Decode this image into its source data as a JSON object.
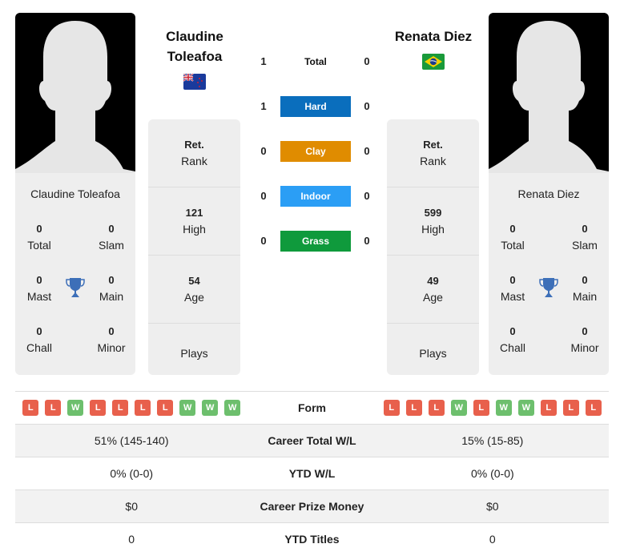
{
  "colors": {
    "hard": "#0a6ebd",
    "clay": "#e08c00",
    "indoor": "#2b9ef5",
    "grass": "#0f9a3c",
    "loss": "#e8604c",
    "win": "#6dbf6d",
    "trophy": "#3d6fb8"
  },
  "player1": {
    "name": "Claudine Toleafoa",
    "name_line1": "Claudine",
    "name_line2": "Toleafoa",
    "flag": "new-zealand",
    "rank_value": "Ret.",
    "rank_label": "Rank",
    "high_value": "121",
    "high_label": "High",
    "age_value": "54",
    "age_label": "Age",
    "plays_label": "Plays",
    "titles": {
      "total": "0",
      "total_label": "Total",
      "slam": "0",
      "slam_label": "Slam",
      "mast": "0",
      "mast_label": "Mast",
      "main": "0",
      "main_label": "Main",
      "chall": "0",
      "chall_label": "Chall",
      "minor": "0",
      "minor_label": "Minor"
    },
    "form": [
      "L",
      "L",
      "W",
      "L",
      "L",
      "L",
      "L",
      "W",
      "W",
      "W"
    ],
    "career_wl": "51% (145-140)",
    "ytd_wl": "0% (0-0)",
    "prize_money": "$0",
    "ytd_titles": "0"
  },
  "player2": {
    "name": "Renata Diez",
    "flag": "brazil",
    "rank_value": "Ret.",
    "rank_label": "Rank",
    "high_value": "599",
    "high_label": "High",
    "age_value": "49",
    "age_label": "Age",
    "plays_label": "Plays",
    "titles": {
      "total": "0",
      "total_label": "Total",
      "slam": "0",
      "slam_label": "Slam",
      "mast": "0",
      "mast_label": "Mast",
      "main": "0",
      "main_label": "Main",
      "chall": "0",
      "chall_label": "Chall",
      "minor": "0",
      "minor_label": "Minor"
    },
    "form": [
      "L",
      "L",
      "L",
      "W",
      "L",
      "W",
      "W",
      "L",
      "L",
      "L"
    ],
    "career_wl": "15% (15-85)",
    "ytd_wl": "0% (0-0)",
    "prize_money": "$0",
    "ytd_titles": "0"
  },
  "h2h": [
    {
      "surface": "Total",
      "p1": "1",
      "p2": "0"
    },
    {
      "surface": "Hard",
      "p1": "1",
      "p2": "0"
    },
    {
      "surface": "Clay",
      "p1": "0",
      "p2": "0"
    },
    {
      "surface": "Indoor",
      "p1": "0",
      "p2": "0"
    },
    {
      "surface": "Grass",
      "p1": "0",
      "p2": "0"
    }
  ],
  "comparison_labels": {
    "form": "Form",
    "career_wl": "Career Total W/L",
    "ytd_wl": "YTD W/L",
    "prize_money": "Career Prize Money",
    "ytd_titles": "YTD Titles"
  }
}
